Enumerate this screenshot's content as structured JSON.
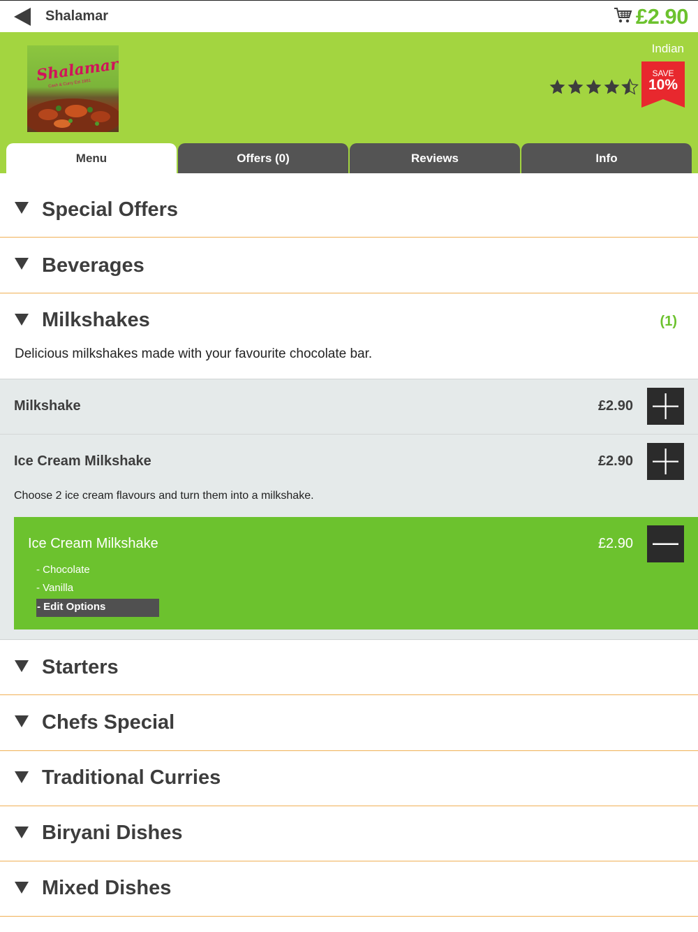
{
  "topbar": {
    "title": "Shalamar",
    "cart_total": "£2.90"
  },
  "icons": {
    "back": "back-arrow-icon",
    "cart": "shopping-cart-icon",
    "star": "star-icon",
    "plus": "plus-icon",
    "minus": "minus-icon",
    "expand": "triangle-down-icon"
  },
  "restaurant": {
    "logo_text": "Shalamar",
    "logo_subtext": "Cash & Curry Est 1981",
    "cuisine": "Indian",
    "rating": 4.5,
    "rating_max": 5,
    "badge_small": "SAVE",
    "badge_big": "10%"
  },
  "tabs": [
    {
      "label": "Menu",
      "active": true
    },
    {
      "label": "Offers (0)",
      "active": false
    },
    {
      "label": "Reviews",
      "active": false
    },
    {
      "label": "Info",
      "active": false
    }
  ],
  "categories": {
    "special_offers": "Special Offers",
    "beverages": "Beverages",
    "milkshakes": "Milkshakes",
    "milkshakes_count": "(1)",
    "milkshakes_desc": "Delicious milkshakes made with your favourite chocolate bar.",
    "starters": "Starters",
    "chefs_special": "Chefs Special",
    "traditional_curries": "Traditional Curries",
    "biryani_dishes": "Biryani Dishes",
    "mixed_dishes": "Mixed Dishes"
  },
  "items": [
    {
      "name": "Milkshake",
      "price": "£2.90"
    },
    {
      "name": "Ice Cream Milkshake",
      "price": "£2.90",
      "description": "Choose 2 ice cream flavours and turn them into a milkshake."
    }
  ],
  "basket_item": {
    "name": "Ice Cream Milkshake",
    "price": "£2.90",
    "options": [
      "- Chocolate",
      "- Vanilla"
    ],
    "edit_label": "- Edit Options"
  },
  "colors": {
    "header_green": "#a3d540",
    "accent_green": "#6cc22e",
    "tab_dark": "#545454",
    "badge_red": "#e8282e",
    "divider_orange": "#f0b055",
    "button_dark": "#2b2b2b"
  }
}
